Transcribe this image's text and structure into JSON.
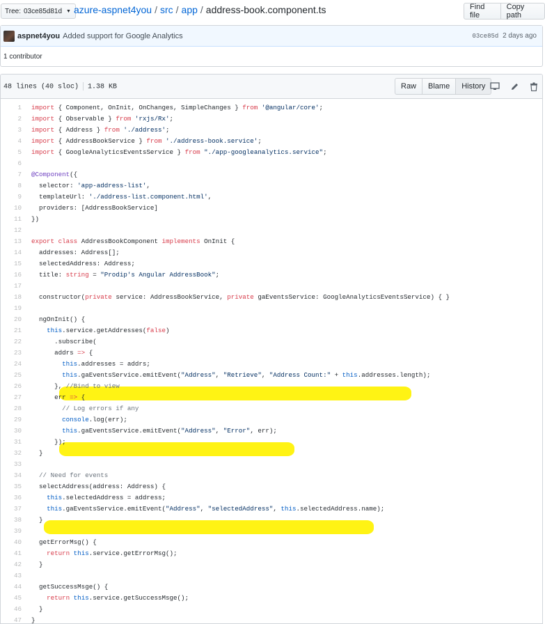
{
  "branch": {
    "label": "Tree:",
    "sha": "03ce85d81d"
  },
  "breadcrumb": {
    "repo": "azure-aspnet4you",
    "sep": "/",
    "dir1": "src",
    "dir2": "app",
    "file": "address-book.component.ts"
  },
  "top_actions": {
    "find_file": "Find file",
    "copy_path": "Copy path"
  },
  "commit": {
    "author": "aspnet4you",
    "message": "Added support for Google Analytics",
    "sha": "03ce85d",
    "time": "2 days ago"
  },
  "contributors": "1 contributor",
  "file": {
    "lines": "48 lines (40 sloc)",
    "size": "1.38 KB",
    "raw": "Raw",
    "blame": "Blame",
    "history": "History"
  },
  "icons": {
    "desktop": "desktop-icon",
    "edit": "pencil-icon",
    "delete": "trash-icon"
  },
  "colors": {
    "highlight": "#fff200",
    "link": "#0366d6"
  },
  "code": [
    {
      "n": "1",
      "t": "import { Component, OnInit, OnChanges, SimpleChanges } from '@angular/core';"
    },
    {
      "n": "2",
      "t": "import { Observable } from 'rxjs/Rx';"
    },
    {
      "n": "3",
      "t": "import { Address } from './address';"
    },
    {
      "n": "4",
      "t": "import { AddressBookService } from './address-book.service';"
    },
    {
      "n": "5",
      "t": "import { GoogleAnalyticsEventsService } from \"./app-googleanalytics.service\";"
    },
    {
      "n": "6",
      "t": ""
    },
    {
      "n": "7",
      "t": "@Component({"
    },
    {
      "n": "8",
      "t": "  selector: 'app-address-list',"
    },
    {
      "n": "9",
      "t": "  templateUrl: './address-list.component.html',"
    },
    {
      "n": "10",
      "t": "  providers: [AddressBookService]"
    },
    {
      "n": "11",
      "t": "})"
    },
    {
      "n": "12",
      "t": ""
    },
    {
      "n": "13",
      "t": "export class AddressBookComponent implements OnInit {"
    },
    {
      "n": "14",
      "t": "  addresses: Address[];"
    },
    {
      "n": "15",
      "t": "  selectedAddress: Address;"
    },
    {
      "n": "16",
      "t": "  title: string = \"Prodip's Angular AddressBook\";"
    },
    {
      "n": "17",
      "t": ""
    },
    {
      "n": "18",
      "t": "  constructor(private service: AddressBookService, private gaEventsService: GoogleAnalyticsEventsService) { }"
    },
    {
      "n": "19",
      "t": ""
    },
    {
      "n": "20",
      "t": "  ngOnInit() {"
    },
    {
      "n": "21",
      "t": "    this.service.getAddresses(false)"
    },
    {
      "n": "22",
      "t": "      .subscribe("
    },
    {
      "n": "23",
      "t": "      addrs => {"
    },
    {
      "n": "24",
      "t": "        this.addresses = addrs;"
    },
    {
      "n": "25",
      "t": "        this.gaEventsService.emitEvent(\"Address\", \"Retrieve\", \"Address Count:\" + this.addresses.length);"
    },
    {
      "n": "26",
      "t": "      }, //Bind to view"
    },
    {
      "n": "27",
      "t": "      err => {"
    },
    {
      "n": "28",
      "t": "        // Log errors if any"
    },
    {
      "n": "29",
      "t": "        console.log(err);"
    },
    {
      "n": "30",
      "t": "        this.gaEventsService.emitEvent(\"Address\", \"Error\", err);"
    },
    {
      "n": "31",
      "t": "      });"
    },
    {
      "n": "32",
      "t": "  }"
    },
    {
      "n": "33",
      "t": ""
    },
    {
      "n": "34",
      "t": "  // Need for events"
    },
    {
      "n": "35",
      "t": "  selectAddress(address: Address) {"
    },
    {
      "n": "36",
      "t": "    this.selectedAddress = address;"
    },
    {
      "n": "37",
      "t": "    this.gaEventsService.emitEvent(\"Address\", \"selectedAddress\", this.selectedAddress.name);"
    },
    {
      "n": "38",
      "t": "  }"
    },
    {
      "n": "39",
      "t": ""
    },
    {
      "n": "40",
      "t": "  getErrorMsg() {"
    },
    {
      "n": "41",
      "t": "    return this.service.getErrorMsg();"
    },
    {
      "n": "42",
      "t": "  }"
    },
    {
      "n": "43",
      "t": ""
    },
    {
      "n": "44",
      "t": "  getSuccessMsge() {"
    },
    {
      "n": "45",
      "t": "    return this.service.getSuccessMsge();"
    },
    {
      "n": "46",
      "t": "  }"
    },
    {
      "n": "47",
      "t": "}"
    }
  ]
}
